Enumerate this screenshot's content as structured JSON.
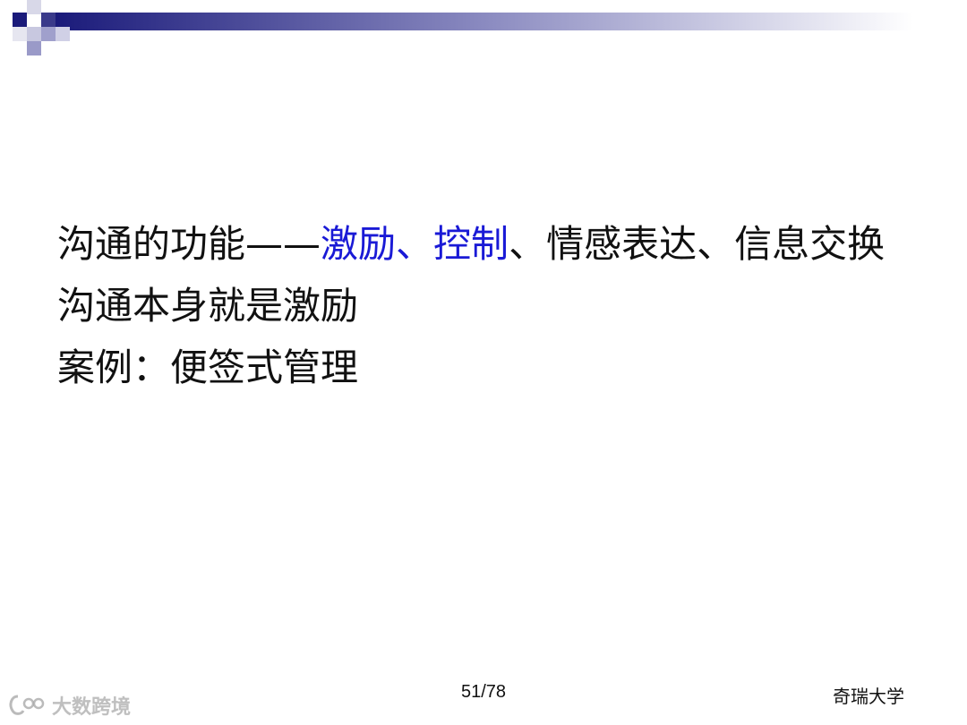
{
  "slide": {
    "line1": {
      "prefix": "沟通的功能——",
      "highlight1": "激励",
      "sep1": "、",
      "highlight2": "控制",
      "suffix": "、情感表达、信息交换"
    },
    "line2": "沟通本身就是激励",
    "line3": "案例：便签式管理"
  },
  "footer": {
    "page": "51/78",
    "org": "奇瑞大学"
  },
  "watermark": {
    "text": "大数跨境"
  },
  "colors": {
    "highlight": "#1a1ad6",
    "deco_dark": "#1a1a7a",
    "deco_light": "#c8c8e0"
  }
}
